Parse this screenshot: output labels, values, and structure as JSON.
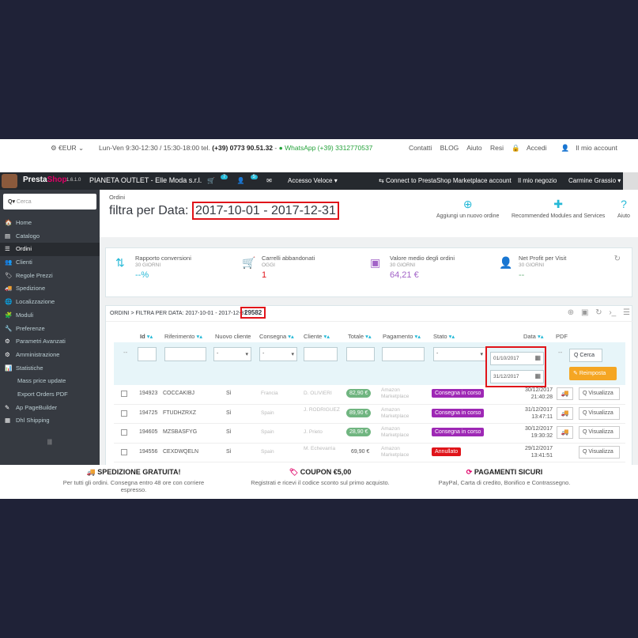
{
  "topbar": {
    "currency": "€EUR",
    "hours": "Lun-Ven 9:30-12:30 / 15:30-18:00 tel.",
    "phone": "(+39) 0773 90.51.32",
    "whatsapp": "WhatsApp (+39) 3312770537",
    "links": [
      "Contatti",
      "BLOG",
      "Aiuto",
      "Resi",
      "Accedi",
      "Il mio account"
    ]
  },
  "admin": {
    "logo_a": "Presta",
    "logo_b": "Shop",
    "version": "1.6.1.0",
    "shop_name": "PIANETA OUTLET - Elle Moda s.r.l.",
    "badge_orders": "7",
    "badge_customers": "5",
    "quick_access": "Accesso Veloce",
    "connect": "Connect to PrestaShop Marketplace account",
    "my_store": "Il mio negozio",
    "user": "Carmine Grassio"
  },
  "sidebar": {
    "search_placeholder": "Cerca",
    "items": [
      {
        "label": "Home",
        "icon": "🏠"
      },
      {
        "label": "Catalogo",
        "icon": "▤"
      },
      {
        "label": "Ordini",
        "icon": "☰"
      },
      {
        "label": "Clienti",
        "icon": "👥"
      },
      {
        "label": "Regole Prezzi",
        "icon": "🏷"
      },
      {
        "label": "Spedizione",
        "icon": "🚚"
      },
      {
        "label": "Localizzazione",
        "icon": "🌐"
      },
      {
        "label": "Moduli",
        "icon": "🧩"
      },
      {
        "label": "Preferenze",
        "icon": "🔧"
      },
      {
        "label": "Parametri Avanzati",
        "icon": "⚙"
      },
      {
        "label": "Amministrazione",
        "icon": "⚙"
      },
      {
        "label": "Statistiche",
        "icon": "📊"
      },
      {
        "label": "Mass price update",
        "icon": ""
      },
      {
        "label": "Export Orders PDF",
        "icon": ""
      },
      {
        "label": "Ap PageBuilder",
        "icon": "✎"
      },
      {
        "label": "Dhl Shipping",
        "icon": "▦"
      }
    ]
  },
  "page": {
    "breadcrumb": "Ordini",
    "title": "filtra per Data:",
    "title_range": "2017-10-01 - 2017-12-31",
    "toolbar": [
      "Aggiungi un nuovo ordine",
      "Recommended Modules and Services",
      "Aiuto"
    ]
  },
  "kpi": [
    {
      "label": "Rapporto conversioni",
      "sub": "30 GIORNI",
      "value": "--%",
      "color": "#25b9d7"
    },
    {
      "label": "Carrelli abbandonati",
      "sub": "OGGI",
      "value": "1",
      "color": "#e0141a"
    },
    {
      "label": "Valore medio degli ordini",
      "sub": "30 GIORNI",
      "value": "64,21 €",
      "color": "#a263c7"
    },
    {
      "label": "Net Profit per Visit",
      "sub": "30 GIORNI",
      "value": "--",
      "color": "#70b580"
    }
  ],
  "orders": {
    "panel_title": "ORDINI > FILTRA PER DATA: 2017-10-01 - 2017-12-31",
    "count": "29582",
    "columns": [
      "Id",
      "Riferimento",
      "Nuovo cliente",
      "Consegna",
      "Cliente",
      "Totale",
      "Pagamento",
      "Stato",
      "Data",
      "PDF"
    ],
    "filter_placeholder": "-",
    "date_from": "01/10/2017",
    "date_to": "31/12/2017",
    "search_btn": "Cerca",
    "reset_btn": "Reimposta",
    "view_btn": "Visualizza",
    "rows": [
      {
        "id": "194923",
        "ref": "COCCAKIBJ",
        "new": "Sì",
        "country": "Francia",
        "customer": "D. OLIVIERI",
        "total": "82,90 €",
        "payment": "Amazon Marketplace",
        "status": "Consegna in corso",
        "status_color": "#9e28b5",
        "date": "30/12/2017",
        "time": "21:40:28"
      },
      {
        "id": "194725",
        "ref": "FTUDHZRXZ",
        "new": "Sì",
        "country": "Spain",
        "customer": "J. RODRIGUEZ",
        "total": "89,90 €",
        "payment": "Amazon Marketplace",
        "status": "Consegna in corso",
        "status_color": "#9e28b5",
        "date": "31/12/2017",
        "time": "13:47:11"
      },
      {
        "id": "194605",
        "ref": "MZSBASFYG",
        "new": "Sì",
        "country": "Spain",
        "customer": "J. Prieto",
        "total": "28,90 €",
        "payment": "Amazon Marketplace",
        "status": "Consegna in corso",
        "status_color": "#9e28b5",
        "date": "30/12/2017",
        "time": "19:30:32"
      },
      {
        "id": "194556",
        "ref": "CEXDWQELN",
        "new": "Sì",
        "country": "Spain",
        "customer": "M. Echevarria",
        "total": "69,90 €",
        "payment": "Amazon Marketplace",
        "status": "Annullato",
        "status_color": "#e0141a",
        "date": "29/12/2017",
        "time": "13:41:51"
      }
    ]
  },
  "footer": [
    {
      "title": "SPEDIZIONE GRATUITA!",
      "icon": "🚚",
      "text": "Per tutti gli ordini. Consegna entro 48 ore con corriere espresso."
    },
    {
      "title": "COUPON €5,00",
      "icon": "🏷",
      "text": "Registrati e ricevi il codice sconto sul primo acquisto."
    },
    {
      "title": "PAGAMENTI SICURI",
      "icon": "⟳",
      "text": "PayPal, Carta di credito, Bonifico e Contrassegno."
    }
  ]
}
